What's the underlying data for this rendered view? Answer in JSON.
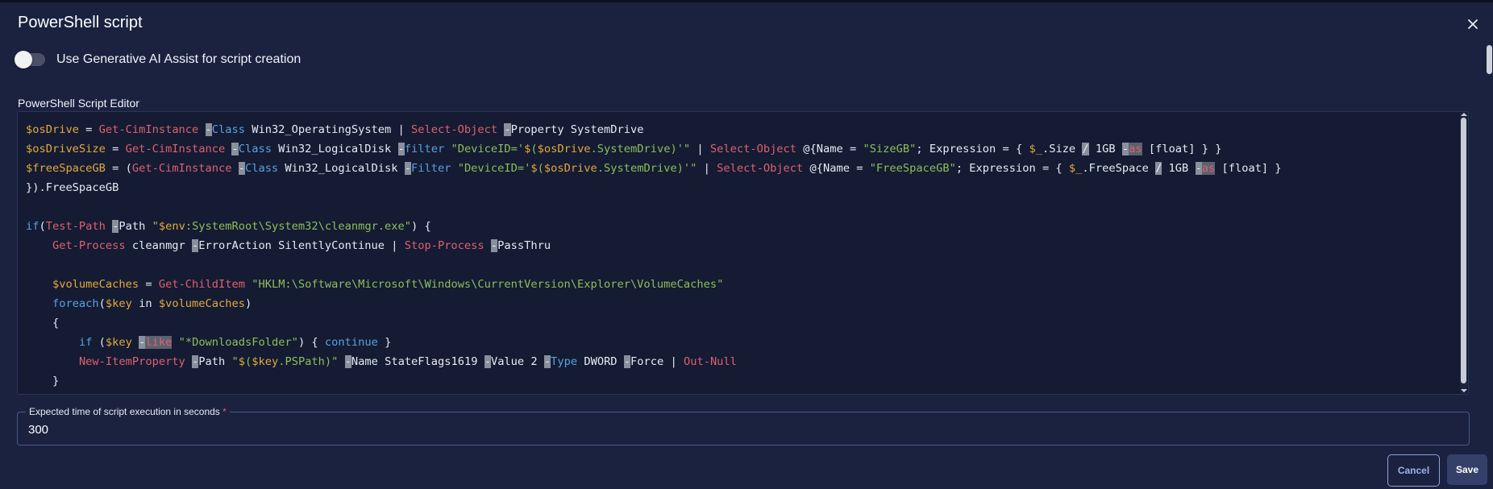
{
  "dialog": {
    "title": "PowerShell script",
    "close_icon": "close-icon"
  },
  "ai_toggle": {
    "label": "Use Generative AI Assist for script creation",
    "enabled": false
  },
  "editor": {
    "label": "PowerShell Script Editor",
    "code_lines": [
      "$osDrive = Get-CimInstance -Class Win32_OperatingSystem | Select-Object -Property SystemDrive",
      "$osDriveSize = Get-CimInstance -Class Win32_LogicalDisk -filter \"DeviceID='$($osDrive.SystemDrive)'\" | Select-Object @{Name = \"SizeGB\"; Expression = { $_.Size / 1GB -as [float] } }",
      "$freeSpaceGB = (Get-CimInstance -Class Win32_LogicalDisk -Filter \"DeviceID='$($osDrive.SystemDrive)'\" | Select-Object @{Name = \"FreeSpaceGB\"; Expression = { $_.FreeSpace / 1GB -as [float] }",
      "}).FreeSpaceGB",
      "",
      "if(Test-Path -Path \"$env:SystemRoot\\System32\\cleanmgr.exe\") {",
      "    Get-Process cleanmgr -ErrorAction SilentlyContinue | Stop-Process -PassThru",
      "",
      "    $volumeCaches = Get-ChildItem \"HKLM:\\Software\\Microsoft\\Windows\\CurrentVersion\\Explorer\\VolumeCaches\"",
      "    foreach($key in $volumeCaches)",
      "    {",
      "        if ($key -like \"*DownloadsFolder\") { continue }",
      "        New-ItemProperty -Path \"$($key.PSPath)\" -Name StateFlags1619 -Value 2 -Type DWORD -Force | Out-Null",
      "    }"
    ]
  },
  "execution_time": {
    "label": "Expected time of script execution in seconds",
    "required_mark": "*",
    "value": "300"
  },
  "buttons": {
    "cancel": "Cancel",
    "save": "Save"
  },
  "colors": {
    "background": "#1a2240",
    "editor_background": "#141b33",
    "variable": "#e5a83a",
    "cmdlet": "#e0606e",
    "string": "#8cbf5a",
    "keyword": "#5aa2e0"
  }
}
